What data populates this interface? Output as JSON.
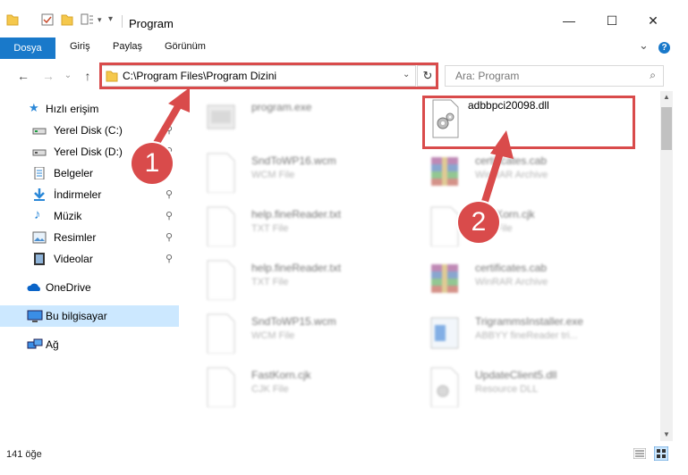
{
  "window": {
    "title": "Program",
    "minimize_glyph": "—",
    "maximize_glyph": "☐",
    "close_glyph": "✕"
  },
  "ribbon": {
    "tabs": [
      "Dosya",
      "Giriş",
      "Paylaş",
      "Görünüm"
    ],
    "expand_glyph": "⌄",
    "help_glyph": "?"
  },
  "navigation": {
    "back_glyph": "←",
    "forward_glyph": "→",
    "recent_glyph": "⌄",
    "up_glyph": "↑",
    "address": "C:\\Program Files\\Program Dizini",
    "address_dropdown_glyph": "⌄",
    "refresh_glyph": "↻",
    "search_placeholder": "Ara: Program",
    "search_glyph": "⌕"
  },
  "sidebar": {
    "quick_access": "Hızlı erişim",
    "items": [
      {
        "label": "Yerel Disk (C:)",
        "icon": "drive-icon"
      },
      {
        "label": "Yerel Disk (D:)",
        "icon": "drive-icon"
      },
      {
        "label": "Belgeler",
        "icon": "documents-icon"
      },
      {
        "label": "İndirmeler",
        "icon": "downloads-icon"
      },
      {
        "label": "Müzik",
        "icon": "music-icon"
      },
      {
        "label": "Resimler",
        "icon": "pictures-icon"
      },
      {
        "label": "Videolar",
        "icon": "videos-icon"
      }
    ],
    "onedrive": "OneDrive",
    "this_pc": "Bu bilgisayar",
    "network": "Ağ",
    "pin_glyph": "📌"
  },
  "files": [
    {
      "name": "program.exe",
      "type": "",
      "icon": "exe-icon"
    },
    {
      "name": "adbbpci20098.dll",
      "type": "",
      "icon": "dll-gear-icon"
    },
    {
      "name": "SndToWP16.wcm",
      "type": "WCM File",
      "icon": "blank-file-icon"
    },
    {
      "name": "certificates.cab",
      "type": "WinRAR Archive",
      "icon": "winrar-icon"
    },
    {
      "name": "help.fineReader.txt",
      "type": "TXT File",
      "icon": "blank-file-icon"
    },
    {
      "name": "FastKorn.cjk",
      "type": "CJK File",
      "icon": "blank-file-icon"
    },
    {
      "name": "help.fineReader.txt",
      "type": "TXT File",
      "icon": "blank-file-icon"
    },
    {
      "name": "certificates.cab",
      "type": "WinRAR Archive",
      "icon": "winrar-icon"
    },
    {
      "name": "SndToWP15.wcm",
      "type": "WCM File",
      "icon": "blank-file-icon"
    },
    {
      "name": "TrigrammsInstaller.exe",
      "type": "ABBYY fineReader tri...",
      "icon": "installer-icon"
    },
    {
      "name": "FastKorn.cjk",
      "type": "CJK File",
      "icon": "blank-file-icon"
    },
    {
      "name": "UpdateClient5.dll",
      "type": "Resource DLL",
      "icon": "dll-gear-icon"
    }
  ],
  "status": {
    "count": "141 öğe"
  },
  "annotations": {
    "badge_1": "1",
    "badge_2": "2"
  },
  "colors": {
    "accent": "#1979ca",
    "highlight_red": "#d94b4b",
    "selected_nav": "#cce8ff"
  }
}
